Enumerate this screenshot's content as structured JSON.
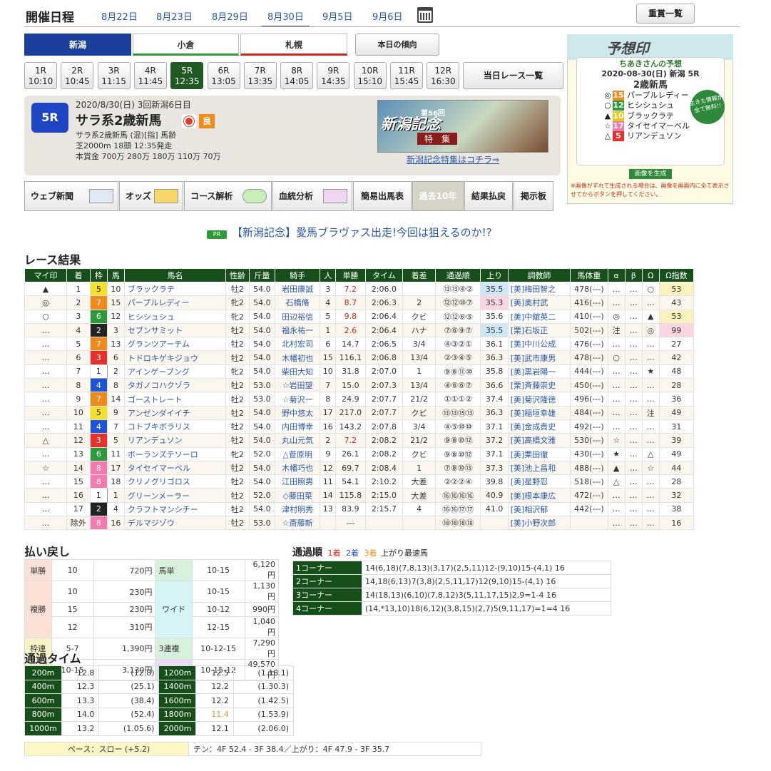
{
  "header": {
    "title": "開催日程",
    "dates": [
      "8月22日",
      "8月23日",
      "8月29日",
      "8月30日",
      "9月5日",
      "9月6日"
    ],
    "active_date": 3,
    "juusho_label": "重賞一覧"
  },
  "venues": [
    "新潟",
    "小倉",
    "札幌"
  ],
  "today_label": "本日の傾向",
  "races": [
    {
      "r": "1R",
      "t": "10:10"
    },
    {
      "r": "2R",
      "t": "10:45"
    },
    {
      "r": "3R",
      "t": "11:15"
    },
    {
      "r": "4R",
      "t": "11:45"
    },
    {
      "r": "5R",
      "t": "12:35"
    },
    {
      "r": "6R",
      "t": "13:05"
    },
    {
      "r": "7R",
      "t": "13:35"
    },
    {
      "r": "8R",
      "t": "14:05"
    },
    {
      "r": "9R",
      "t": "14:35"
    },
    {
      "r": "10R",
      "t": "15:10"
    },
    {
      "r": "11R",
      "t": "15:45"
    },
    {
      "r": "12R",
      "t": "16:30"
    }
  ],
  "race_list_label": "当日レース一覧",
  "race": {
    "num": "5R",
    "date": "2020/8/30(日) 3回新潟6日目",
    "name": "サラ系2歳新馬",
    "cond": "良",
    "info1": "サラ系2歳新馬 (混)[指] 馬齢",
    "info2": "芝2000m 18頭 12:35発走",
    "info3": "本賞金 700万 280万 180万 110万 70万"
  },
  "banner": {
    "title": "新潟記念",
    "sub": "特　集",
    "edition": "第56回",
    "link": "新潟記念特集はコチラ⇒"
  },
  "tools": [
    "ウェブ新聞",
    "オッズ",
    "コース解析",
    "血統分析",
    "簡易出馬表",
    "過去10年",
    "結果払戻",
    "掲示板"
  ],
  "ad": {
    "logo": "予想印",
    "who": "ちあきさんの予想",
    "date": "2020-08-30(日) 新潟 5R",
    "race": "2歳新馬",
    "stamp": "生きた情報が全て無料!!",
    "button": "画像を生成",
    "note": "※画像がずれて生成される場合は、画像を画面内に全て表示させてからボタンを押してください。",
    "picks": [
      {
        "mark": "◎",
        "num": "15",
        "name": "パープルレディー",
        "color": "#f08a1c"
      },
      {
        "mark": "○",
        "num": "12",
        "name": "ヒシシュシュ",
        "color": "#2c9a3a"
      },
      {
        "mark": "▲",
        "num": "10",
        "name": "ブラックラテ",
        "color": "#e8c81a"
      },
      {
        "mark": "☆",
        "num": "17",
        "name": "タイセイマーベル",
        "color": "#f57ab0"
      },
      {
        "mark": "△",
        "num": "5",
        "name": "リアンデュソン",
        "color": "#e8302a"
      }
    ]
  },
  "pr": {
    "badge": "PR",
    "text": "【新潟記念】愛馬ブラヴァス出走!今回は狙えるのか!?"
  },
  "results_title": "レース結果",
  "results_headers": [
    "マイ印",
    "着",
    "枠",
    "馬",
    "馬名",
    "性齢",
    "斤量",
    "騎手",
    "人",
    "単勝",
    "タイム",
    "着差",
    "通過順",
    "上り",
    "調教師",
    "馬体重",
    "α",
    "β",
    "Ω",
    "Ω指数"
  ],
  "results": [
    [
      "▲",
      "1",
      "5",
      "10",
      "ブラックラテ",
      "牡2",
      "54.0",
      "岩田康誠",
      "3",
      "7.2",
      "2:06.0",
      "",
      "⑬⑬④②",
      "35.5",
      "[美]梅田智之",
      "478(---)",
      "…",
      "…",
      "○",
      "53"
    ],
    [
      "◎",
      "2",
      "7",
      "15",
      "パープルレディー",
      "牝2",
      "54.0",
      "石橋脩",
      "4",
      "8.7",
      "2:06.3",
      "2",
      "⑫⑫⑩⑦",
      "35.3",
      "[美]奥村武",
      "416(---)",
      "…",
      "…",
      "…",
      "43"
    ],
    [
      "○",
      "3",
      "6",
      "12",
      "ヒシシュシュ",
      "牝2",
      "54.0",
      "田辺裕信",
      "5",
      "9.8",
      "2:06.4",
      "クビ",
      "⑫⑫⑥⑤",
      "35.6",
      "[美]中舘英二",
      "410(---)",
      "◎",
      "…",
      "▲",
      "53"
    ],
    [
      "…",
      "4",
      "2",
      "3",
      "セブンサミット",
      "牡2",
      "54.0",
      "福永祐一",
      "1",
      "2.6",
      "2:06.4",
      "ハナ",
      "⑦⑥⑨⑦",
      "35.5",
      "[栗]石坂正",
      "502(---)",
      "注",
      "…",
      "◎",
      "99"
    ],
    [
      "…",
      "5",
      "7",
      "13",
      "グランツアーテム",
      "牡2",
      "54.0",
      "北村宏司",
      "6",
      "14.7",
      "2:06.5",
      "3/4",
      "④③②①",
      "36.1",
      "[美]中川公成",
      "476(---)",
      "…",
      "…",
      "…",
      "27"
    ],
    [
      "…",
      "6",
      "3",
      "6",
      "トドロキゲキジョウ",
      "牡2",
      "54.0",
      "木幡初也",
      "15",
      "116.1",
      "2:06.8",
      "13/4",
      "②③④⑤",
      "36.3",
      "[美]武市康男",
      "478(---)",
      "○",
      "…",
      "…",
      "42"
    ],
    [
      "…",
      "7",
      "1",
      "2",
      "アインゲーブング",
      "牝2",
      "54.0",
      "柴田大知",
      "10",
      "31.8",
      "2:07.0",
      "1",
      "⑨⑧⑪⑩",
      "35.8",
      "[美]黒岩陽一",
      "444(---)",
      "…",
      "…",
      "★",
      "48"
    ],
    [
      "…",
      "8",
      "4",
      "8",
      "タガノコハクゾラ",
      "牡2",
      "53.0",
      "☆岩田望",
      "7",
      "15.0",
      "2:07.3",
      "13/4",
      "④⑥⑥⑦",
      "36.6",
      "[栗]斉藤崇史",
      "450(---)",
      "…",
      "…",
      "…",
      "28"
    ],
    [
      "…",
      "9",
      "7",
      "14",
      "ゴーストレート",
      "牡2",
      "53.0",
      "☆菊沢一",
      "8",
      "24.9",
      "2:07.7",
      "21/2",
      "①①①②",
      "37.4",
      "[美]菊沢隆徳",
      "496(---)",
      "…",
      "…",
      "…",
      "36"
    ],
    [
      "…",
      "10",
      "5",
      "9",
      "アンゼンダイイチ",
      "牡2",
      "54.0",
      "野中悠太",
      "17",
      "217.0",
      "2:07.7",
      "クビ",
      "⑬⑬⑮⑬",
      "36.3",
      "[美]稲垣幸雄",
      "484(---)",
      "…",
      "…",
      "注",
      "49"
    ],
    [
      "…",
      "11",
      "4",
      "7",
      "コトブキボラリス",
      "牡2",
      "54.0",
      "内田博幸",
      "16",
      "143.2",
      "2:07.8",
      "3/4",
      "④⑤⑩⑩",
      "37.1",
      "[美]金成貴史",
      "492(---)",
      "…",
      "…",
      "…",
      "31"
    ],
    [
      "△",
      "12",
      "3",
      "5",
      "リアンデュソン",
      "牡2",
      "54.0",
      "丸山元気",
      "2",
      "7.2",
      "2:08.2",
      "21/2",
      "⑨⑧⑩⑫",
      "37.2",
      "[美]高橋文雅",
      "530(---)",
      "☆",
      "…",
      "…",
      "39"
    ],
    [
      "…",
      "13",
      "6",
      "11",
      "ボーランズテソーロ",
      "牝2",
      "52.0",
      "△菅原明",
      "9",
      "26.1",
      "2:08.2",
      "クビ",
      "⑨⑧⑩⑫",
      "37.1",
      "[美]栗田徹",
      "430(---)",
      "★",
      "…",
      "△",
      "49"
    ],
    [
      "☆",
      "14",
      "8",
      "17",
      "タイセイマーベル",
      "牡2",
      "54.0",
      "木幡巧也",
      "12",
      "69.7",
      "2:08.4",
      "1",
      "⑦⑧⑩⑬",
      "37.3",
      "[美]池上昌和",
      "488(---)",
      "▲",
      "…",
      "☆",
      "44"
    ],
    [
      "…",
      "15",
      "8",
      "18",
      "クリノグリゴロス",
      "牡2",
      "54.0",
      "江田照男",
      "11",
      "54.1",
      "2:10.2",
      "大差",
      "②②②④",
      "39.8",
      "[美]星野忍",
      "518(---)",
      "△",
      "…",
      "…",
      "28"
    ],
    [
      "…",
      "16",
      "1",
      "1",
      "グリーンメーラー",
      "牡2",
      "52.0",
      "◇藤田菜",
      "14",
      "115.8",
      "2:15.0",
      "大差",
      "⑯⑯⑯⑯",
      "40.9",
      "[美]根本康広",
      "472(---)",
      "…",
      "…",
      "…",
      "32"
    ],
    [
      "…",
      "17",
      "2",
      "4",
      "クラフトマンシチー",
      "牡2",
      "54.0",
      "津村明秀",
      "13",
      "83.9",
      "2:15.7",
      "4",
      "⑯⑯⑰⑰",
      "41.0",
      "[美]相沢郁",
      "442(---)",
      "…",
      "…",
      "…",
      "38"
    ],
    [
      "…",
      "除外",
      "8",
      "16",
      "デルマジゾウ",
      "牡2",
      "53.0",
      "☆斎藤新",
      "",
      "---",
      "",
      "",
      "⑱⑱⑱⑱",
      "",
      "[美]小野次郎",
      "",
      "…",
      "…",
      "…",
      "16"
    ]
  ],
  "payout_title": "払い戻し",
  "payout": {
    "tansho": {
      "k": "単勝",
      "n": "10",
      "y": "720円"
    },
    "fukusho": {
      "k": "複勝",
      "rows": [
        [
          "10",
          "230円"
        ],
        [
          "15",
          "230円"
        ],
        [
          "12",
          "310円"
        ]
      ]
    },
    "wakuren": {
      "k": "枠連",
      "n": "5-7",
      "y": "1,390円"
    },
    "umaren": {
      "k": "馬連",
      "n": "10-15",
      "y": "3,130円"
    },
    "umatan": {
      "k": "馬単",
      "n": "10-15",
      "y": "6,120円"
    },
    "wide": {
      "k": "ワイド",
      "rows": [
        [
          "10-15",
          "1,130円"
        ],
        [
          "10-12",
          "990円"
        ],
        [
          "12-15",
          "1,040円"
        ]
      ]
    },
    "sanrenpuku": {
      "k": "3連複",
      "n": "10-12-15",
      "y": "7,290円"
    },
    "sanrentan": {
      "k": "3連単",
      "n": "10-15-12",
      "y": "49,570円"
    }
  },
  "passing_title": "通過順",
  "passing_legend": [
    "1着",
    "2着",
    "3着",
    "上がり最速馬"
  ],
  "passing": [
    {
      "h": "1コーナー",
      "v": "14(6,18)(7,8,13)(3,17)(2,5,11)12-(9,10)15-(4,1) 16"
    },
    {
      "h": "2コーナー",
      "v": "14,18(6,13)7(3,8)(2,5,11,17)12(9,10)15-(4,1) 16"
    },
    {
      "h": "3コーナー",
      "v": "14(18,13)(6,10)(7,8,12)3(5,11,17,15)2,9=1-4 16"
    },
    {
      "h": "4コーナー",
      "v": "(14,*13,10)18(6,12)(3,8,15)(2,7)5(9,11,17)=1=4 16"
    }
  ],
  "lap_title": "通過タイム",
  "laps": [
    [
      "200m",
      "12.8",
      "(12.8)",
      "1200m",
      "12.5",
      "(1.18.1)"
    ],
    [
      "400m",
      "12.3",
      "(25.1)",
      "1400m",
      "12.2",
      "(1.30.3)"
    ],
    [
      "600m",
      "13.3",
      "(38.4)",
      "1600m",
      "12.2",
      "(1.42.5)"
    ],
    [
      "800m",
      "14.0",
      "(52.4)",
      "1800m",
      "11.4",
      "(1.53.9)"
    ],
    [
      "1000m",
      "13.2",
      "(1.05.6)",
      "2000m",
      "12.1",
      "(2.06.0)"
    ]
  ],
  "pace": {
    "label": "ペース：スロー (+5.2)",
    "detail": "テン：4F 52.4 - 3F 38.4／上がり：4F 47.9 - 3F 35.7"
  }
}
